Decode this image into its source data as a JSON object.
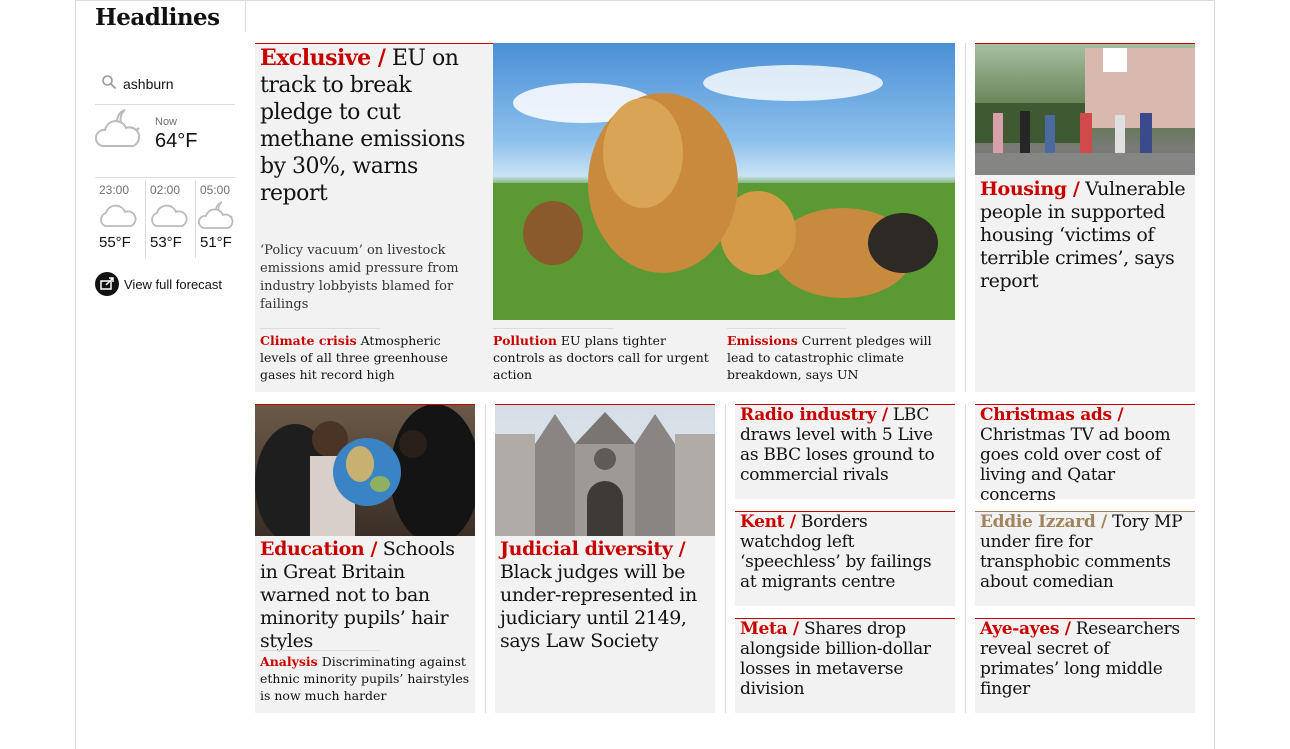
{
  "section": {
    "title": "Headlines"
  },
  "weather": {
    "search_value": "ashburn",
    "now_label": "Now",
    "now_temp": "64°F",
    "now_icon": "partly-cloudy-night-icon",
    "forecast": [
      {
        "time": "23:00",
        "temp": "55°F",
        "icon": "cloud-icon"
      },
      {
        "time": "02:00",
        "temp": "53°F",
        "icon": "cloud-icon"
      },
      {
        "time": "05:00",
        "temp": "51°F",
        "icon": "partly-cloudy-night-icon"
      }
    ],
    "full_forecast_label": "View full forecast"
  },
  "colors": {
    "news_red": "#c70000",
    "card_bg": "#f2f2f2",
    "comment_tan": "#a1845c"
  },
  "lead": {
    "kicker": "Exclusive /",
    "headline": "EU on track to break pledge to cut methane emissions by 30%, warns report",
    "trail": "‘Policy vacuum’ on livestock emissions amid pressure from industry lobbyists blamed for failings",
    "sublinks": [
      {
        "kicker": "Climate crisis",
        "text": "Atmospheric levels of all three greenhouse gases hit record high"
      },
      {
        "kicker": "Pollution",
        "text": "EU plans tighter controls as doctors call for urgent action"
      },
      {
        "kicker": "Emissions",
        "text": "Current pledges will lead to catastrophic climate breakdown, says UN"
      }
    ]
  },
  "housing": {
    "kicker": "Housing /",
    "headline": "Vulnerable people in supported housing ‘victims of terrible crimes’, says report"
  },
  "education": {
    "kicker": "Education /",
    "headline": "Schools in Great Britain warned not to ban minority pupils’ hair styles",
    "sub_kicker": "Analysis",
    "sub_text": "Discriminating against ethnic minority pupils’ hairstyles is now much harder"
  },
  "judicial": {
    "kicker": "Judicial diversity /",
    "headline": "Black judges will be under-represented in judiciary until 2149, says Law Society"
  },
  "small_stories": [
    {
      "kicker": "Radio industry /",
      "headline": "LBC draws level with 5 Live as BBC loses ground to commercial rivals"
    },
    {
      "kicker": "Kent /",
      "headline": "Borders watchdog left ‘speechless’ by failings at migrants centre"
    },
    {
      "kicker": "Meta /",
      "headline": "Shares drop alongside billion-dollar losses in metaverse division"
    },
    {
      "kicker": "Christmas ads /",
      "headline": "Christmas TV ad boom goes cold over cost of living and Qatar concerns"
    },
    {
      "kicker": "Eddie Izzard /",
      "headline": "Tory MP under fire for transphobic comments about comedian"
    },
    {
      "kicker": "Aye-ayes /",
      "headline": "Researchers reveal secret of primates’ long middle finger"
    }
  ]
}
